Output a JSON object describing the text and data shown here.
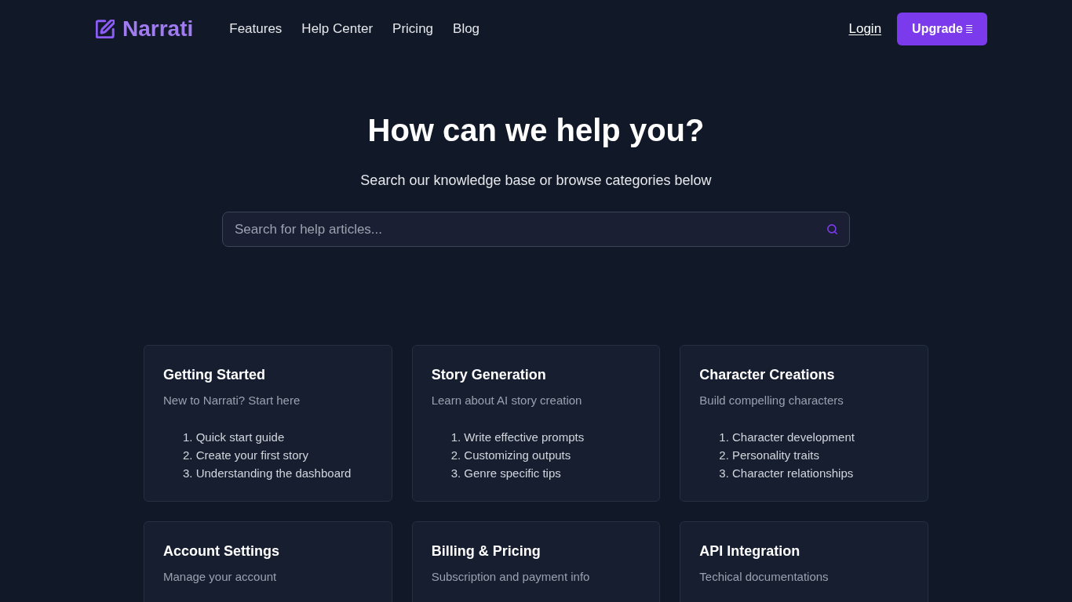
{
  "header": {
    "logo": {
      "text": "Narrati"
    },
    "nav": [
      {
        "label": "Features"
      },
      {
        "label": "Help Center"
      },
      {
        "label": "Pricing"
      },
      {
        "label": "Blog"
      }
    ],
    "login": {
      "label": "Login"
    },
    "upgrade": {
      "label": "Upgrade"
    }
  },
  "hero": {
    "title": "How can we help you?",
    "subtitle": "Search our knowledge base or browse categories below",
    "search": {
      "placeholder": "Search for help articles..."
    }
  },
  "categories": [
    {
      "title": "Getting Started",
      "description": "New to Narrati? Start here",
      "articles": [
        "1. Quick start guide",
        "2. Create your first story",
        "3. Understanding the dashboard"
      ]
    },
    {
      "title": "Story Generation",
      "description": "Learn about AI story creation",
      "articles": [
        "1. Write effective prompts",
        "2. Customizing outputs",
        "3. Genre specific tips"
      ]
    },
    {
      "title": "Character Creations",
      "description": "Build compelling characters",
      "articles": [
        "1. Character development",
        "2. Personality traits",
        "3. Character relationships"
      ]
    },
    {
      "title": "Account Settings",
      "description": "Manage your account"
    },
    {
      "title": "Billing & Pricing",
      "description": "Subscription and payment info"
    },
    {
      "title": "API Integration",
      "description": "Techical documentations"
    }
  ]
}
